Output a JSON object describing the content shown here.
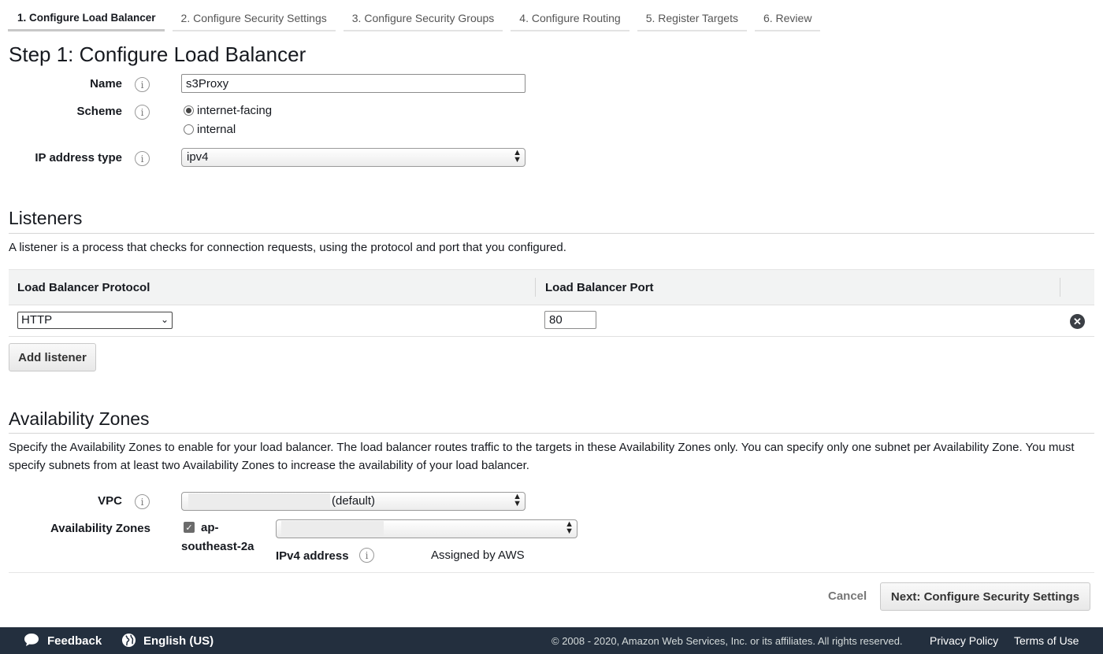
{
  "tabs": [
    {
      "label": "1. Configure Load Balancer",
      "active": true
    },
    {
      "label": "2. Configure Security Settings"
    },
    {
      "label": "3. Configure Security Groups"
    },
    {
      "label": "4. Configure Routing"
    },
    {
      "label": "5. Register Targets"
    },
    {
      "label": "6. Review"
    }
  ],
  "step_title": "Step 1: Configure Load Balancer",
  "basic": {
    "name_label": "Name",
    "name_value": "s3Proxy",
    "scheme_label": "Scheme",
    "scheme_options": [
      "internet-facing",
      "internal"
    ],
    "scheme_selected": "internet-facing",
    "ip_label": "IP address type",
    "ip_value": "ipv4",
    "info_glyph": "i"
  },
  "listeners": {
    "title": "Listeners",
    "description": "A listener is a process that checks for connection requests, using the protocol and port that you configured.",
    "col_protocol": "Load Balancer Protocol",
    "col_port": "Load Balancer Port",
    "rows": [
      {
        "protocol": "HTTP",
        "port": "80"
      }
    ],
    "add_button": "Add listener"
  },
  "azs": {
    "title": "Availability Zones",
    "description": "Specify the Availability Zones to enable for your load balancer. The load balancer routes traffic to the targets in these Availability Zones only. You can specify only one subnet per Availability Zone. You must specify subnets from at least two Availability Zones to increase the availability of your load balancer.",
    "vpc_label": "VPC",
    "vpc_value": "(default)",
    "zones_label": "Availability Zones",
    "zone_name_line1": "ap-",
    "zone_name_line2": "southeast-2a",
    "ipv4_label": "IPv4 address",
    "ipv4_value": "Assigned by AWS"
  },
  "actions": {
    "cancel": "Cancel",
    "next": "Next: Configure Security Settings"
  },
  "footer": {
    "feedback": "Feedback",
    "language": "English (US)",
    "copyright": "© 2008 - 2020, Amazon Web Services, Inc. or its affiliates. All rights reserved.",
    "privacy": "Privacy Policy",
    "terms": "Terms of Use"
  },
  "icons": {
    "info": "info-icon",
    "remove": "remove-circle-icon",
    "feedback": "speech-bubble-icon",
    "language": "globe-icon"
  },
  "colors": {
    "footer_bg": "#232f3e",
    "text": "#16191f",
    "table_header_bg": "#f2f3f3"
  }
}
